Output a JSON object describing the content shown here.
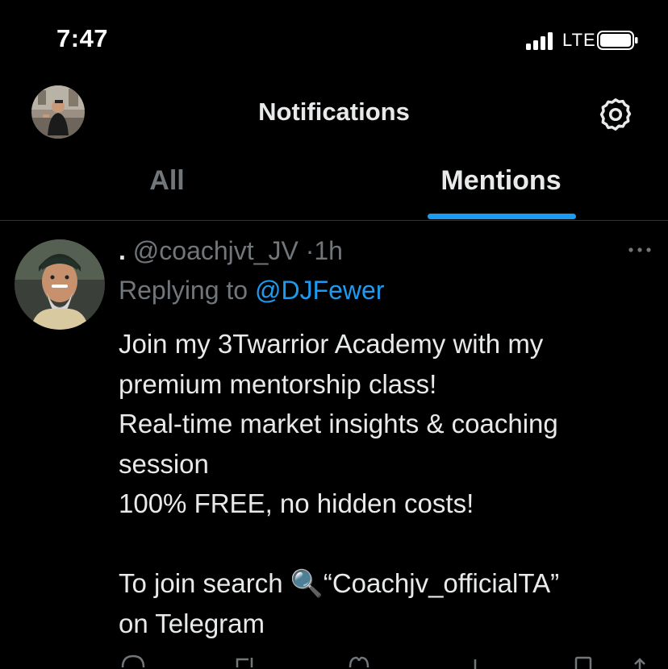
{
  "status_bar": {
    "time": "7:47",
    "network": "LTE",
    "signal_icon": "cellular-signal-icon",
    "battery_icon": "battery-icon"
  },
  "header": {
    "title": "Notifications",
    "avatar_icon": "profile-avatar",
    "settings_icon": "gear-icon"
  },
  "tabs": [
    {
      "label": "All",
      "selected": false
    },
    {
      "label": "Mentions",
      "selected": true
    }
  ],
  "tweet": {
    "display_name": ".",
    "handle": "@coachjvt_JV",
    "separator": "·",
    "time": "1h",
    "replying_prefix": "Replying to",
    "replying_to": "@DJFewer",
    "text": "Join my 3Twarrior Academy with my\npremium mentorship class!\nReal-time market insights & coaching\nsession\n100% FREE, no hidden costs!\n\nTo join search 🔍“Coachjv_officialTA”\non Telegram",
    "more_icon": "more-options-icon"
  },
  "colors": {
    "background": "#000000",
    "text_primary": "#e7e9ea",
    "text_secondary": "#71767b",
    "accent": "#1d9bf0",
    "divider": "#2f3336"
  }
}
